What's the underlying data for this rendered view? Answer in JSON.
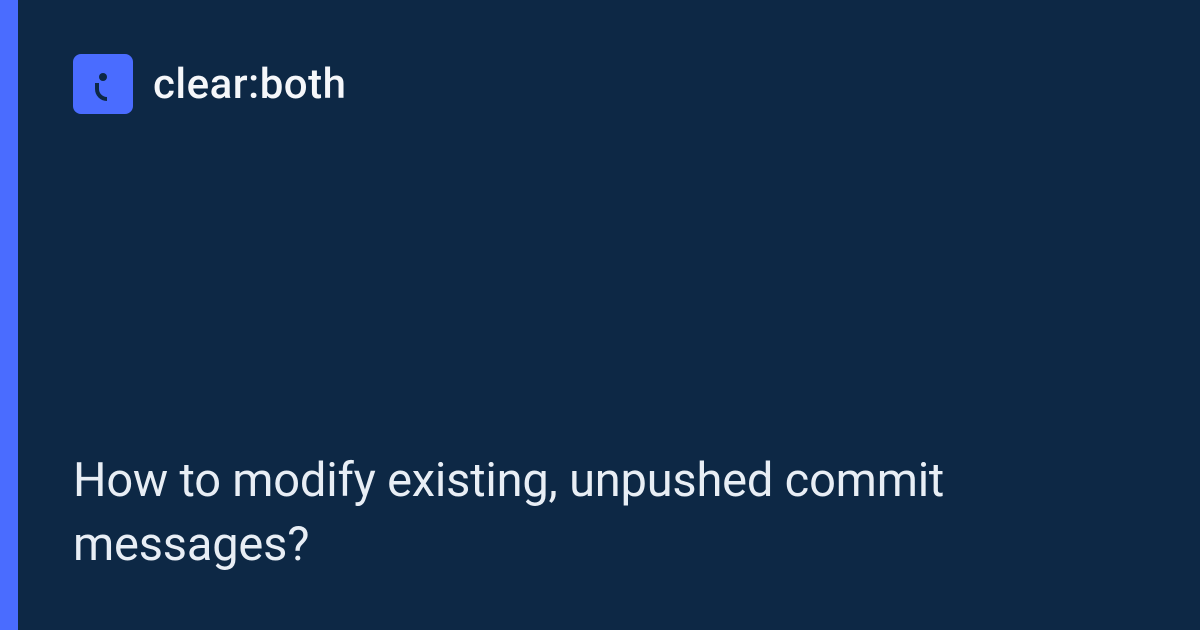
{
  "brand": {
    "name": "clear:both",
    "icon": "semicolon-icon",
    "accent_color": "#4a6cff",
    "bg_color": "#0d2845"
  },
  "title": "How to modify existing, unpushed commit messages?"
}
